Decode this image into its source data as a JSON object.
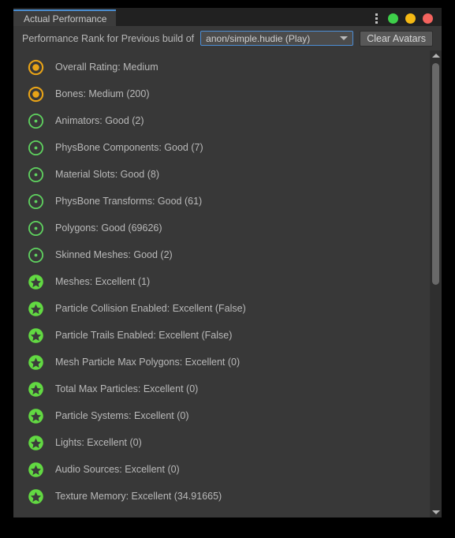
{
  "window": {
    "tab_label": "Actual Performance",
    "controls": {
      "menu_icon": "kebab-menu-icon",
      "dots": [
        {
          "name": "green",
          "color": "#3ecf4a"
        },
        {
          "name": "yellow",
          "color": "#f5b914"
        },
        {
          "name": "red",
          "color": "#f4635e"
        }
      ]
    }
  },
  "toolbar": {
    "label": "Performance Rank for Previous build of",
    "dropdown_value": "anon/simple.hudie (Play)",
    "clear_button": "Clear Avatars"
  },
  "ratings": {
    "medium_color": "#e8a317",
    "good_color": "#5fd35f",
    "excellent_color": "#62d942"
  },
  "list": [
    {
      "rank": "medium",
      "label": "Overall Rating: Medium"
    },
    {
      "rank": "medium",
      "label": "Bones: Medium (200)"
    },
    {
      "rank": "good",
      "label": "Animators: Good (2)"
    },
    {
      "rank": "good",
      "label": "PhysBone Components: Good (7)"
    },
    {
      "rank": "good",
      "label": "Material Slots: Good (8)"
    },
    {
      "rank": "good",
      "label": "PhysBone Transforms: Good (61)"
    },
    {
      "rank": "good",
      "label": "Polygons: Good (69626)"
    },
    {
      "rank": "good",
      "label": "Skinned Meshes: Good (2)"
    },
    {
      "rank": "excellent",
      "label": "Meshes: Excellent (1)"
    },
    {
      "rank": "excellent",
      "label": "Particle Collision Enabled: Excellent (False)"
    },
    {
      "rank": "excellent",
      "label": "Particle Trails Enabled: Excellent (False)"
    },
    {
      "rank": "excellent",
      "label": "Mesh Particle Max Polygons: Excellent (0)"
    },
    {
      "rank": "excellent",
      "label": "Total Max Particles: Excellent (0)"
    },
    {
      "rank": "excellent",
      "label": "Particle Systems: Excellent (0)"
    },
    {
      "rank": "excellent",
      "label": "Lights: Excellent (0)"
    },
    {
      "rank": "excellent",
      "label": "Audio Sources: Excellent (0)"
    },
    {
      "rank": "excellent",
      "label": "Texture Memory: Excellent (34.91665)"
    }
  ],
  "scrollbar": {
    "up_icon": "scroll-up-arrow-icon",
    "down_icon": "scroll-down-arrow-icon"
  }
}
